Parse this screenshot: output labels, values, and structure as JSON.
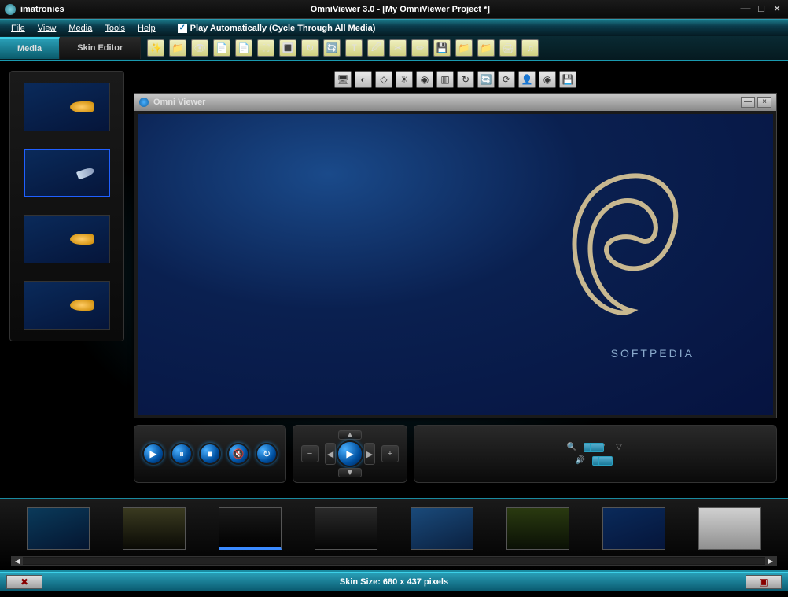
{
  "titlebar": {
    "brand": "imatronics",
    "title": "OmniViewer 3.0 - [My OmniViewer Project *]"
  },
  "menu": {
    "file": "File",
    "view": "View",
    "media": "Media",
    "tools": "Tools",
    "help": "Help",
    "autoplay": "Play Automatically (Cycle Through All Media)"
  },
  "tabs": {
    "media": "Media",
    "skin": "Skin Editor"
  },
  "viewer": {
    "title": "Omni Viewer",
    "watermark": "SOFTPEDIA"
  },
  "status": {
    "label": "Skin Size: 680 x 437 pixels"
  },
  "icons": {
    "top": [
      "✨",
      "📁",
      "👁",
      "📄",
      "📄",
      "⛶",
      "🔳",
      "↻",
      "🔄",
      "T",
      "🖉",
      "✂",
      "✏",
      "💾",
      "📁",
      "📁",
      "🖨",
      "♫"
    ],
    "sec": [
      "🖥",
      "◐",
      "◇",
      "☀",
      "◉",
      "▥",
      "↻",
      "🔄",
      "⟳",
      "👤",
      "◉",
      "💾"
    ]
  }
}
